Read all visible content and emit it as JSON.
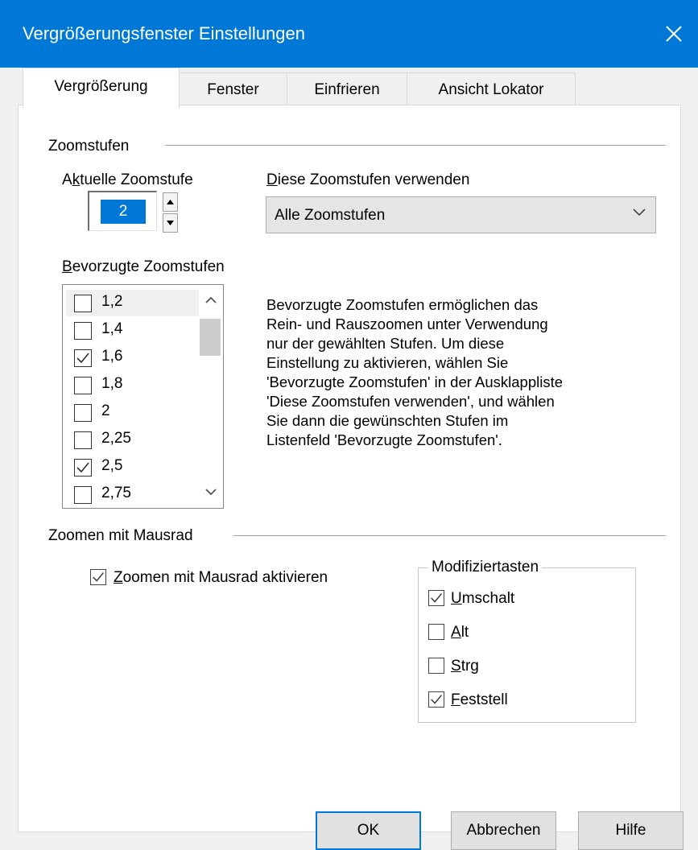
{
  "window": {
    "title": "Vergrößerungsfenster Einstellungen"
  },
  "tabs": [
    {
      "label": "Vergrößerung",
      "active": true
    },
    {
      "label": "Fenster",
      "active": false
    },
    {
      "label": "Einfrieren",
      "active": false
    },
    {
      "label": "Ansicht Lokator",
      "active": false
    }
  ],
  "zoom_section": {
    "heading": "Zoomstufen",
    "current_label_pre": "A",
    "current_label_key": "k",
    "current_label_post": "tuelle Zoomstufe",
    "current_value": "2",
    "use_levels_label_pre": "",
    "use_levels_label_key": "D",
    "use_levels_label_post": "iese Zoomstufen verwenden",
    "use_levels_selected": "Alle Zoomstufen",
    "preferred_label_pre": "",
    "preferred_label_key": "B",
    "preferred_label_post": "evorzugte Zoomstufen",
    "preferred_levels": [
      {
        "label": "1,2",
        "checked": false
      },
      {
        "label": "1,4",
        "checked": false
      },
      {
        "label": "1,6",
        "checked": true
      },
      {
        "label": "1,8",
        "checked": false
      },
      {
        "label": "2",
        "checked": false
      },
      {
        "label": "2,25",
        "checked": false
      },
      {
        "label": "2,5",
        "checked": true
      },
      {
        "label": "2,75",
        "checked": false
      }
    ],
    "description_lines": [
      "Bevorzugte Zoomstufen ermöglichen das",
      "Rein- und Rauszoomen unter Verwendung",
      "nur der gewählten Stufen. Um diese",
      "Einstellung zu aktivieren, wählen Sie",
      "'Bevorzugte Zoomstufen' in der Ausklappliste",
      "'Diese Zoomstufen verwenden', und wählen",
      "Sie dann die gewünschten Stufen im",
      "Listenfeld 'Bevorzugte Zoomstufen'."
    ]
  },
  "mouse_section": {
    "heading": "Zoomen mit Mausrad",
    "enable_key": "Z",
    "enable_rest": "oomen mit Mausrad aktivieren",
    "enable_checked": true,
    "modifier_group_label": "Modifiziertasten",
    "modifiers": [
      {
        "key": "U",
        "rest": "mschalt",
        "checked": true
      },
      {
        "key": "A",
        "rest": "lt",
        "checked": false
      },
      {
        "key": "S",
        "rest": "trg",
        "checked": false
      },
      {
        "key": "F",
        "rest": "eststell",
        "checked": true
      }
    ]
  },
  "buttons": {
    "ok": "OK",
    "cancel": "Abbrechen",
    "help": "Hilfe"
  },
  "colors": {
    "titlebar": "#0078d7",
    "accent": "#0078d7"
  }
}
